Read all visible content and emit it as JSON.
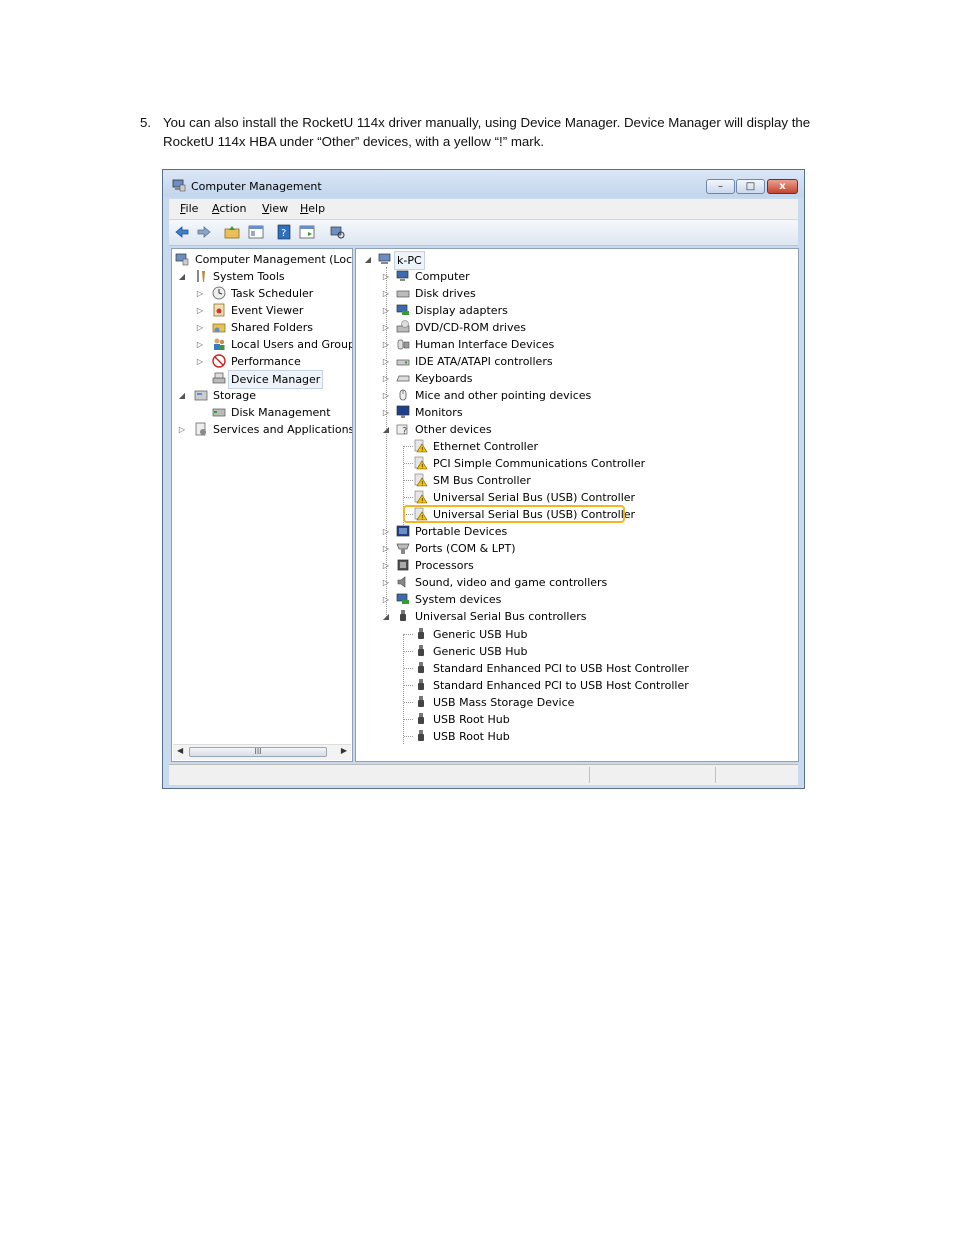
{
  "instruction": {
    "number": "5.",
    "text": "You can also install the RocketU 114x driver manually, using Device Manager. Device Manager will display the RocketU 114x HBA under “Other” devices, with a yellow “!” mark."
  },
  "window": {
    "title": "Computer Management",
    "controls": {
      "minimize": "–",
      "maximize": "□",
      "close": "x"
    }
  },
  "menu": [
    {
      "label": "File",
      "accel": "F",
      "rest": "ile"
    },
    {
      "label": "Action",
      "accel": "A",
      "rest": "ction"
    },
    {
      "label": "View",
      "accel": "V",
      "rest": "iew"
    },
    {
      "label": "Help",
      "accel": "H",
      "rest": "elp"
    }
  ],
  "left_tree": {
    "root": "Computer Management (Local",
    "system_tools": "System Tools",
    "task_scheduler": "Task Scheduler",
    "event_viewer": "Event Viewer",
    "shared_folders": "Shared Folders",
    "local_users": "Local Users and Groups",
    "performance": "Performance",
    "device_manager": "Device Manager",
    "storage": "Storage",
    "disk_management": "Disk Management",
    "services_apps": "Services and Applications",
    "scroll_thumb": "III"
  },
  "right_tree": {
    "root": "k-PC",
    "computer": "Computer",
    "disk_drives": "Disk drives",
    "display_adapters": "Display adapters",
    "dvd": "DVD/CD-ROM drives",
    "hid": "Human Interface Devices",
    "ide": "IDE ATA/ATAPI controllers",
    "keyboards": "Keyboards",
    "mice": "Mice and other pointing devices",
    "monitors": "Monitors",
    "other_devices": "Other devices",
    "other_children": [
      "Ethernet Controller",
      "PCI Simple Communications Controller",
      "SM Bus Controller",
      "Universal Serial Bus (USB) Controller",
      "Universal Serial Bus (USB) Controller"
    ],
    "portable": "Portable Devices",
    "ports": "Ports (COM & LPT)",
    "processors": "Processors",
    "sound": "Sound, video and game controllers",
    "system_devices": "System devices",
    "usb_controllers": "Universal Serial Bus controllers",
    "usb_children": [
      "Generic USB Hub",
      "Generic USB Hub",
      "Standard Enhanced PCI to USB Host Controller",
      "Standard Enhanced PCI to USB Host Controller",
      "USB Mass Storage Device",
      "USB Root Hub",
      "USB Root Hub"
    ]
  },
  "colors": {
    "highlight_border": "#f0b623",
    "warning_yellow": "#f5c400",
    "window_frame": "#c9d9ee"
  }
}
